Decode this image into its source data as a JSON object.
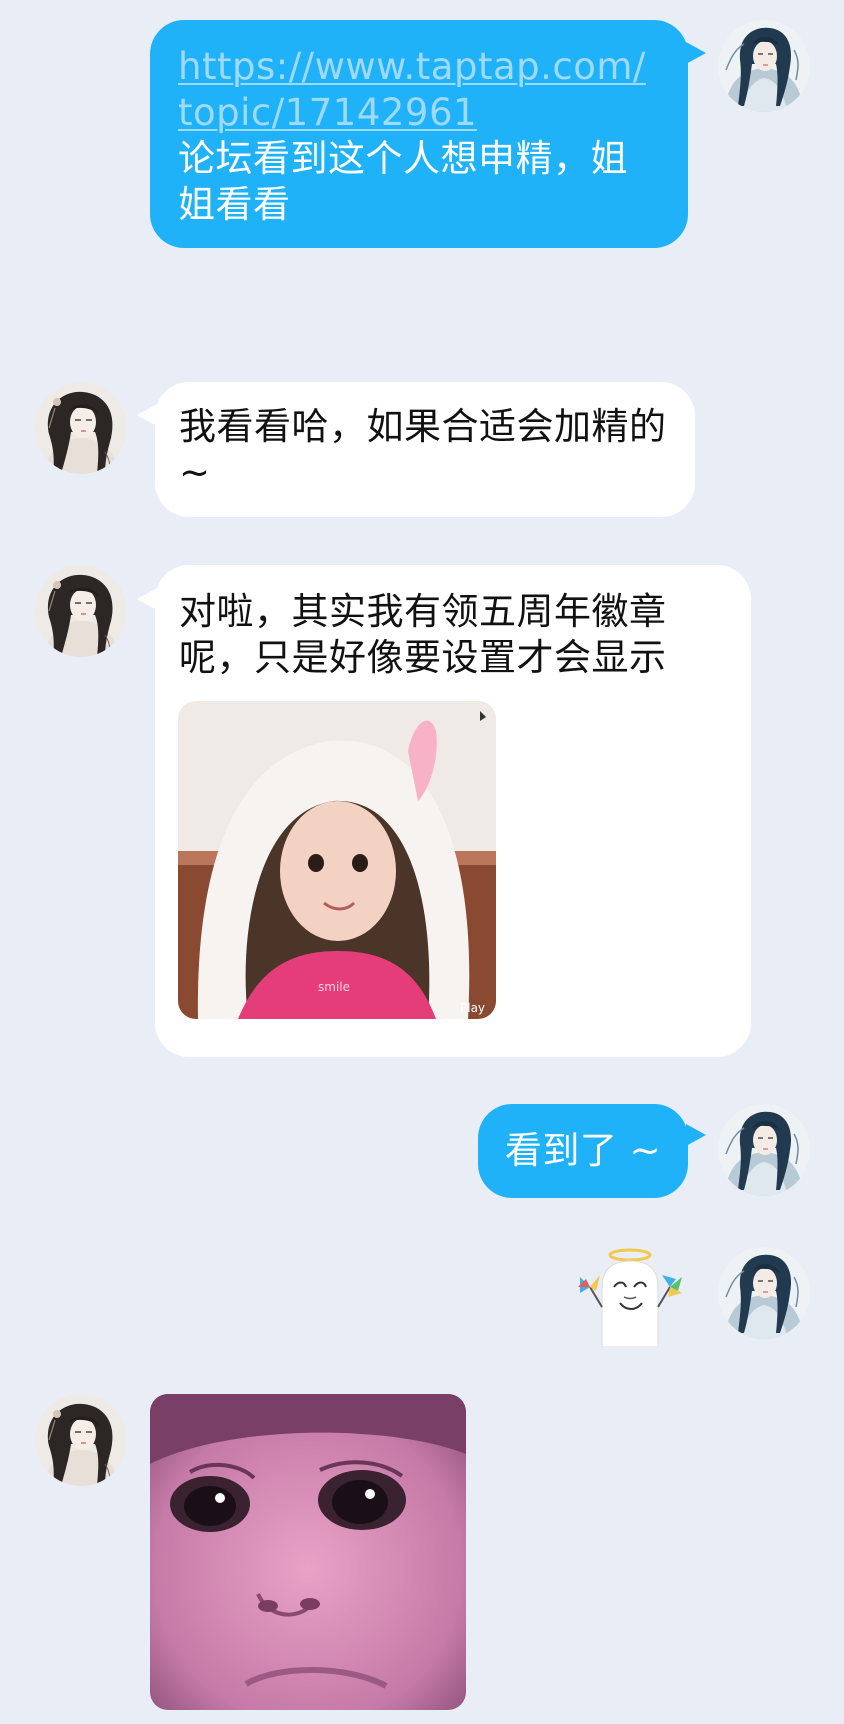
{
  "messages": [
    {
      "direction": "outgoing",
      "link": "https://www.taptap.com/topic/17142961",
      "link_line1": "https://www.taptap.com/",
      "link_line2": "topic/17142961",
      "text": "论坛看到这个人想申精，姐姐看看"
    },
    {
      "direction": "incoming",
      "text": "我看看哈，如果合适会加精的~"
    },
    {
      "direction": "incoming",
      "text": "对啦，其实我有领五周年徽章呢，只是好像要设置才会显示",
      "image": {
        "icon": "photo-girl-white-bunny-hood",
        "watermark_left": "smile",
        "watermark_right": "Play"
      }
    },
    {
      "direction": "outgoing",
      "text": "看到了 ~"
    },
    {
      "direction": "outgoing",
      "sticker": "meme-face-angel-pinwheels-sticker"
    },
    {
      "direction": "incoming",
      "image": {
        "icon": "photo-child-face-closeup"
      }
    }
  ],
  "colors": {
    "background": "#e9edf5",
    "outgoing_bubble": "#1fb2f9",
    "incoming_bubble": "#ffffff",
    "link": "#9fd9fc"
  },
  "avatars": {
    "self": "avatar-ink-painting-man",
    "other": "avatar-ink-painting-woman"
  }
}
